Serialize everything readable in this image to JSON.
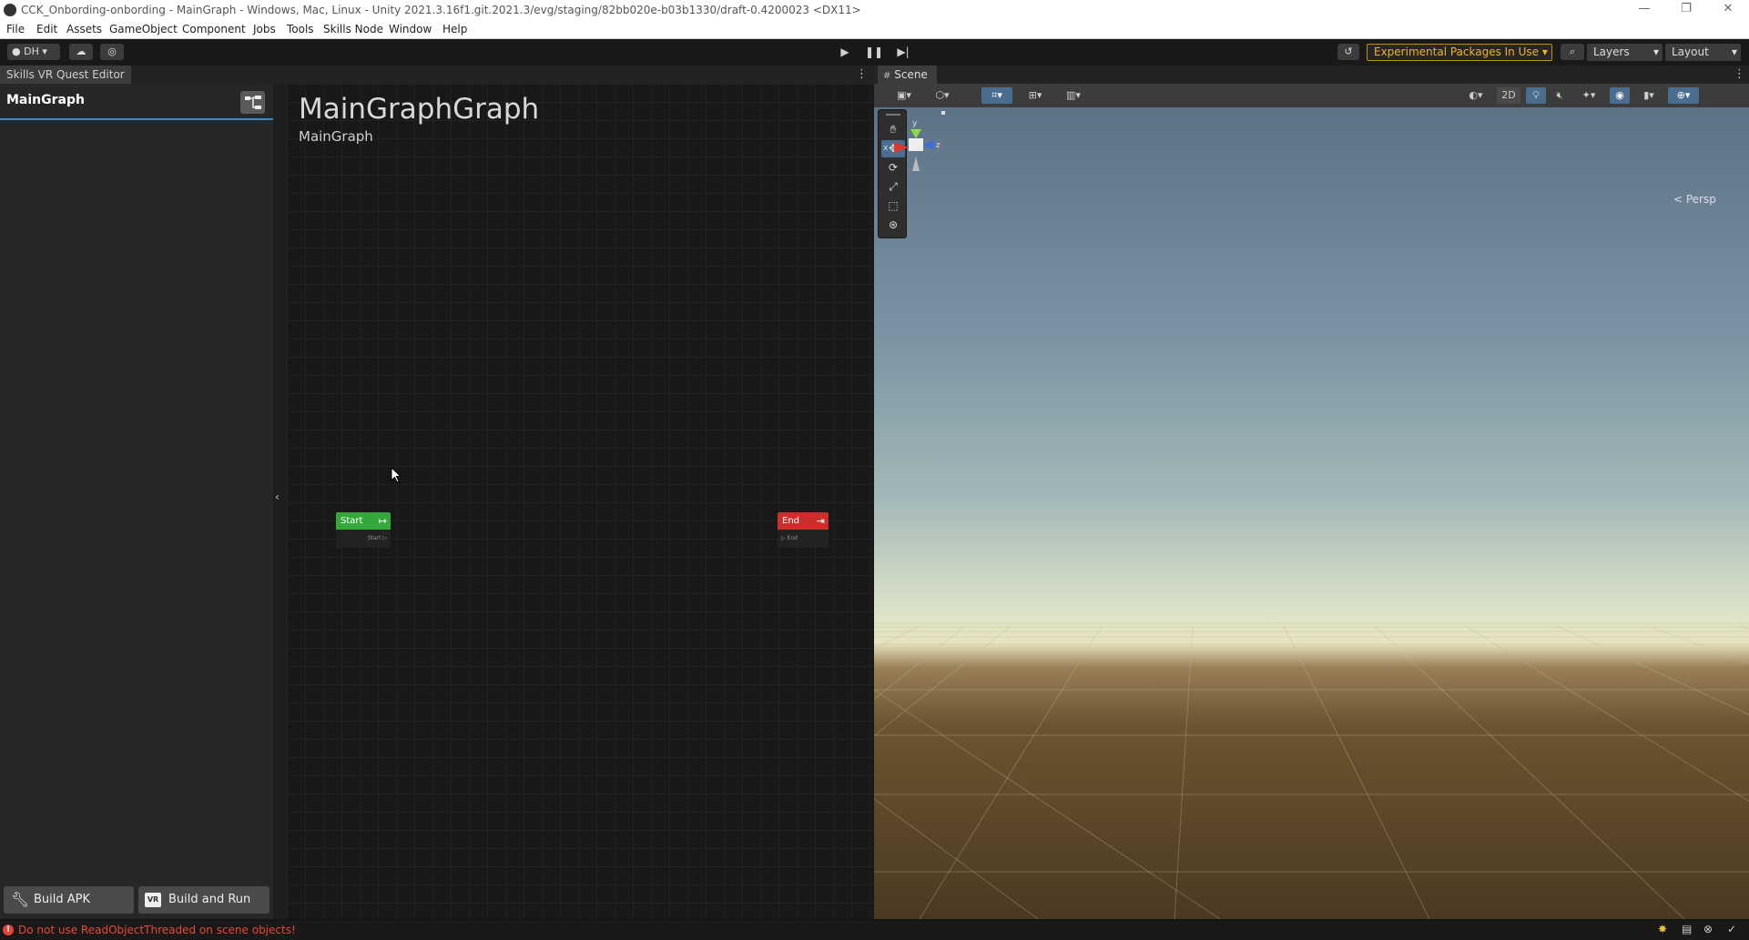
{
  "window": {
    "title": "CCK_Onbording-onbording - MainGraph - Windows, Mac, Linux - Unity 2021.3.16f1.git.2021.3/evg/staging/82bb020e-b03b1330/draft-0.4200023 <DX11>",
    "controls": [
      "—",
      "❐",
      "✕"
    ]
  },
  "menu": [
    "File",
    "Edit",
    "Assets",
    "GameObject",
    "Component",
    "Jobs",
    "Tools",
    "Skills Node",
    "Window",
    "Help"
  ],
  "toolbar": {
    "account_label": "DH",
    "experimental_label": "Experimental Packages In Use ▾",
    "layers_label": "Layers",
    "layout_label": "Layout"
  },
  "editor": {
    "tab_label": "Skills VR Quest Editor",
    "graph_list_item": "MainGraph",
    "graph_title": "MainGraphGraph",
    "graph_subtitle": "MainGraph",
    "build_apk_label": "Build APK",
    "build_run_label": "Build and Run",
    "build_run_badge": "VR",
    "start_node": {
      "title": "Start",
      "port": "Start ▷"
    },
    "end_node": {
      "title": "End",
      "port": "▷ End"
    }
  },
  "scene": {
    "tab_label": "Scene",
    "mode_2d": "2D",
    "persp_label": "< Persp",
    "axis_labels": {
      "x": "x",
      "y": "y",
      "z": "z"
    }
  },
  "status": {
    "message": "Do not use ReadObjectThreaded on scene objects!"
  },
  "colors": {
    "accent_blue": "#2b8fcf",
    "start_green": "#35a83b",
    "end_red": "#c9302c",
    "warning_orange": "#f0b429",
    "error_red": "#e34a3a"
  }
}
